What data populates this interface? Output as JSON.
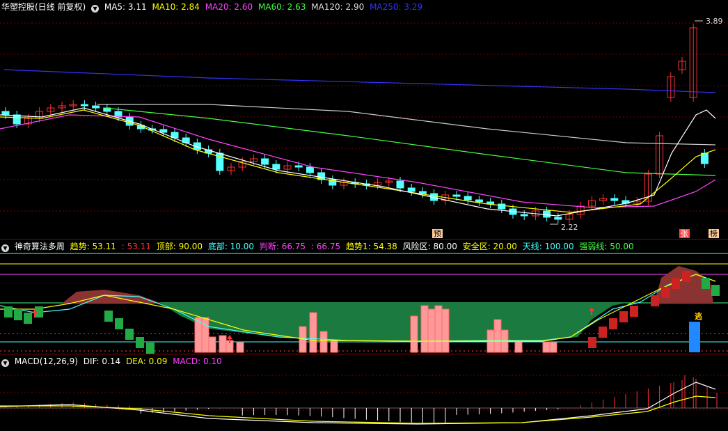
{
  "main": {
    "title": "华塑控股(日线 前复权)",
    "indicators": [
      {
        "label": "MA5: 3.11",
        "color": "#ffffff"
      },
      {
        "label": "MA10: 2.84",
        "color": "#ffff00"
      },
      {
        "label": "MA20: 2.60",
        "color": "#ff44ff"
      },
      {
        "label": "MA60: 2.63",
        "color": "#44ff44"
      },
      {
        "label": "MA120: 2.90",
        "color": "#dddddd"
      },
      {
        "label": "MA250: 3.29",
        "color": "#3333ff"
      }
    ],
    "high_label": "3.89",
    "low_label": "2.22",
    "tags": {
      "yu": "预",
      "zhang": "张",
      "bang": "榜"
    }
  },
  "sub1": {
    "title": "神奇算法多周",
    "indicators": [
      {
        "label": "趋势: 53.11",
        "color": "#ffff00"
      },
      {
        "label": ": 53.11",
        "color": "#ff3333"
      },
      {
        "label": "顶部: 90.00",
        "color": "#ffff00"
      },
      {
        "label": "底部: 10.00",
        "color": "#44ffff"
      },
      {
        "label": "判断: 66.75",
        "color": "#ff44ff"
      },
      {
        "label": ": 66.75",
        "color": "#ff44ff"
      },
      {
        "label": "趋势1: 54.38",
        "color": "#ffff00"
      },
      {
        "label": "风险区: 80.00",
        "color": "#ffffff"
      },
      {
        "label": "安全区: 20.00",
        "color": "#ffff00"
      },
      {
        "label": "天线: 100.00",
        "color": "#44ffff"
      },
      {
        "label": "强弱线: 50.00",
        "color": "#44ff44"
      }
    ],
    "escape_label": "逃"
  },
  "sub2": {
    "title": "MACD(12,26,9)",
    "indicators": [
      {
        "label": "DIF: 0.14",
        "color": "#ffffff"
      },
      {
        "label": "DEA: 0.09",
        "color": "#ffff00"
      },
      {
        "label": "MACD: 0.10",
        "color": "#ff44ff"
      }
    ]
  },
  "colors": {
    "up": "#ff3232",
    "down": "#54ffff",
    "grid": "#8a0000",
    "bg": "#000000"
  },
  "icons": {
    "settings": "circle-down-icon"
  }
}
